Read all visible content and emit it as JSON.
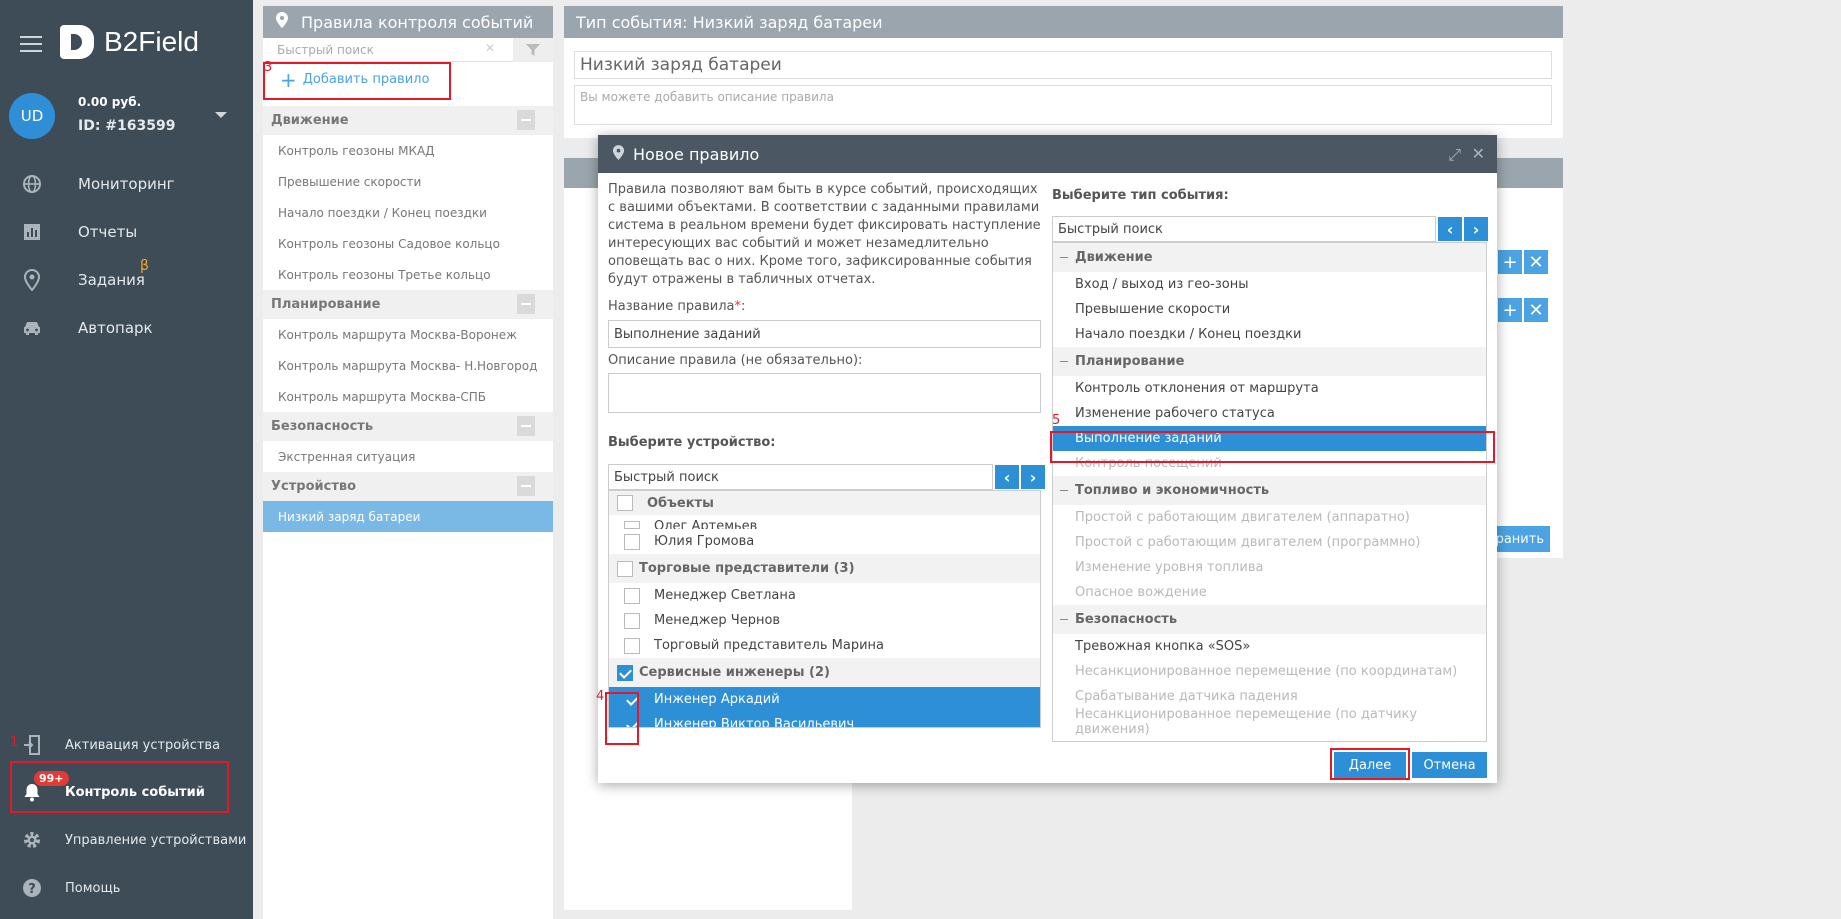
{
  "app": {
    "logo": "B2Field"
  },
  "user": {
    "initials": "UD",
    "balance": "0.00 руб.",
    "id": "ID: #163599"
  },
  "nav": {
    "items": [
      "Мониторинг",
      "Отчеты",
      "Задания",
      "Автопарк"
    ],
    "beta": "β",
    "bottom": [
      "Активация устройства",
      "Контроль событий",
      "Управление устройствами",
      "Помощь"
    ],
    "badge": "99+"
  },
  "annotations": {
    "n1": "1",
    "n3": "3",
    "n4": "4",
    "n5": "5"
  },
  "rules_panel": {
    "title": "Правила контроля событий",
    "search_placeholder": "Быстрый поиск",
    "add": "Добавить правило",
    "groups": [
      {
        "name": "Движение",
        "items": [
          "Контроль геозоны МКАД",
          "Превышение скорости",
          "Начало поездки / Конец поездки",
          "Контроль геозоны Садовое кольцо",
          "Контроль геозоны Третье кольцо"
        ]
      },
      {
        "name": "Планирование",
        "items": [
          "Контроль маршрута Москва-Воронеж",
          "Контроль маршрута Москва- Н.Новгород",
          "Контроль маршрута Москва-СПБ"
        ]
      },
      {
        "name": "Безопасность",
        "items": [
          "Экстренная ситуация"
        ]
      },
      {
        "name": "Устройство",
        "items": [
          "Низкий заряд батареи"
        ]
      }
    ]
  },
  "event_panel": {
    "title": "Тип события: Низкий заряд батареи",
    "name_value": "Низкий заряд батареи",
    "desc_placeholder": "Вы можете добавить описание правила",
    "save": "хранить"
  },
  "modal": {
    "title": "Новое правило",
    "intro": "Правила позволяют вам быть в курсе событий, происходящих с вашими объектами. В соответствии с заданными правилами система в реальном времени будет фиксировать наступление интересующих вас событий и может незамедлительно оповещать вас о них. Кроме того, зафиксированные события будут отражены в табличных отчетах.",
    "name_label": "Название правила",
    "required": "*",
    "name_value": "Выполнение заданий",
    "desc_label": "Описание правила (не обязательно):",
    "device_label": "Выберите устройство:",
    "search_placeholder": "Быстрый поиск",
    "objects_header": "Объекты",
    "devices": [
      {
        "label": "Олег Артемьев",
        "type": "item",
        "checked": false
      },
      {
        "label": "Юлия Громова",
        "type": "item",
        "checked": false
      },
      {
        "label": "Торговые представители (3)",
        "type": "group",
        "checked": false
      },
      {
        "label": "Менеджер Светлана",
        "type": "item",
        "checked": false
      },
      {
        "label": "Менеджер Чернов",
        "type": "item",
        "checked": false
      },
      {
        "label": "Торговый представитель Марина",
        "type": "item",
        "checked": false
      },
      {
        "label": "Сервисные инженеры (2)",
        "type": "group",
        "checked": true
      },
      {
        "label": "Инженер Аркадий",
        "type": "item",
        "checked": true
      },
      {
        "label": "Инженер Виктор Васильевич",
        "type": "item",
        "checked": true
      }
    ],
    "event_label": "Выберите тип события:",
    "events": [
      {
        "label": "Движение",
        "type": "group"
      },
      {
        "label": "Вход / выход из гео-зоны",
        "type": "item"
      },
      {
        "label": "Превышение скорости",
        "type": "item"
      },
      {
        "label": "Начало поездки / Конец поездки",
        "type": "item"
      },
      {
        "label": "Планирование",
        "type": "group"
      },
      {
        "label": "Контроль отклонения от маршрута",
        "type": "item"
      },
      {
        "label": "Изменение рабочего статуса",
        "type": "item"
      },
      {
        "label": "Выполнение заданий",
        "type": "selected"
      },
      {
        "label": "Контроль посещений",
        "type": "disabled"
      },
      {
        "label": "Топливо и экономичность",
        "type": "group"
      },
      {
        "label": "Простой с работающим двигателем (аппаратно)",
        "type": "disabled"
      },
      {
        "label": "Простой с работающим двигателем (программно)",
        "type": "disabled"
      },
      {
        "label": "Изменение уровня топлива",
        "type": "disabled"
      },
      {
        "label": "Опасное вождение",
        "type": "disabled"
      },
      {
        "label": "Безопасность",
        "type": "group"
      },
      {
        "label": "Тревожная кнопка «SOS»",
        "type": "item"
      },
      {
        "label": "Несанкционированное перемещение (по координатам)",
        "type": "disabled"
      },
      {
        "label": "Срабатывание датчика падения",
        "type": "disabled"
      },
      {
        "label": "Несанкционированное перемещение (по датчику движения)",
        "type": "disabled"
      }
    ],
    "next": "Далее",
    "cancel": "Отмена"
  },
  "colors": {
    "sidebar": "#3d4c57",
    "accent": "#2d8fd5",
    "highlight": "#e3192a"
  }
}
